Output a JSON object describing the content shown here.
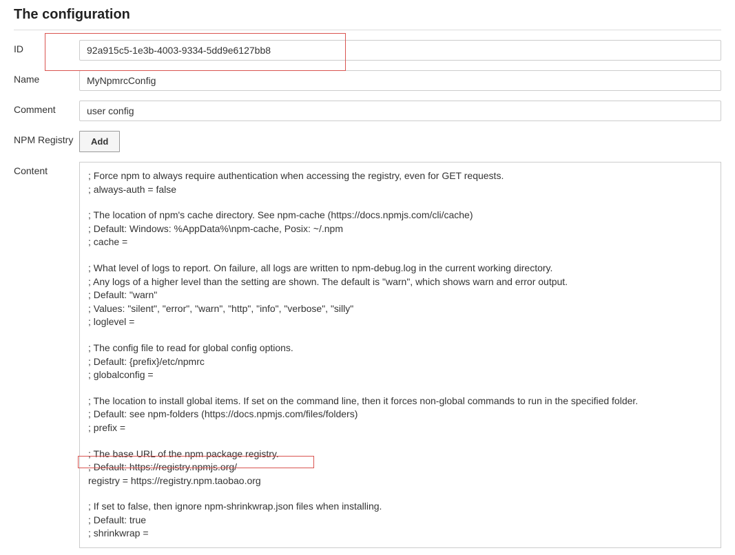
{
  "title": "The configuration",
  "labels": {
    "id": "ID",
    "name": "Name",
    "comment": "Comment",
    "npm_registry": "NPM Registry",
    "content": "Content"
  },
  "fields": {
    "id": "92a915c5-1e3b-4003-9334-5dd9e6127bb8",
    "name": "MyNpmrcConfig",
    "comment": "user config",
    "add_button": "Add"
  },
  "content": {
    "block1": {
      "l1": "; Force npm to always require authentication when accessing the registry, even for GET requests.",
      "l2": "; always-auth = false"
    },
    "block2": {
      "l1": "; The location of npm's cache directory. See npm-cache (https://docs.npmjs.com/cli/cache)",
      "l2": "; Default: Windows: %AppData%\\npm-cache, Posix: ~/.npm",
      "l3": "; cache ="
    },
    "block3": {
      "l1": "; What level of logs to report. On failure, all logs are written to npm-debug.log in the current working directory.",
      "l2": "; Any logs of a higher level than the setting are shown. The default is \"warn\", which shows warn and error output.",
      "l3": "; Default: \"warn\"",
      "l4": "; Values: \"silent\", \"error\", \"warn\", \"http\", \"info\", \"verbose\", \"silly\"",
      "l5": "; loglevel ="
    },
    "block4": {
      "l1": "; The config file to read for global config options.",
      "l2": "; Default: {prefix}/etc/npmrc",
      "l3": "; globalconfig ="
    },
    "block5": {
      "l1": "; The location to install global items. If set on the command line, then it forces non-global commands to run in the specified folder.",
      "l2": "; Default: see npm-folders (https://docs.npmjs.com/files/folders)",
      "l3": "; prefix ="
    },
    "block6": {
      "l1": "; The base URL of the npm package registry.",
      "l2": "; Default: https://registry.npmjs.org/",
      "l3": " registry =   https://registry.npm.taobao.org"
    },
    "block7": {
      "l1": "; If set to false, then ignore npm-shrinkwrap.json files when installing.",
      "l2": "; Default: true",
      "l3": "; shrinkwrap ="
    }
  }
}
